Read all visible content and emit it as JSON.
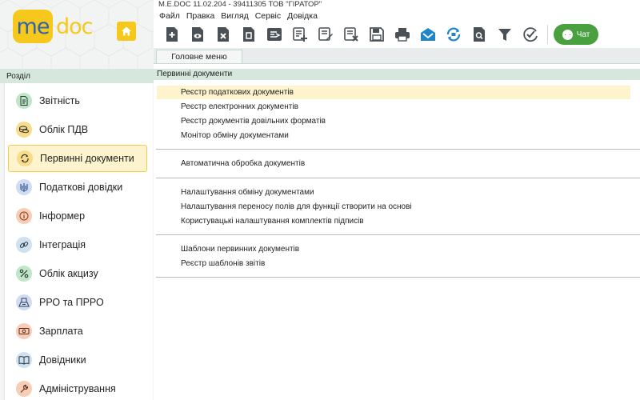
{
  "window": {
    "title": "M.E.DOC 11.02.204  - 39411305 ТОВ \"ГІРАТОР\""
  },
  "logo": {
    "part1": "me",
    "part2": "doc"
  },
  "menu": [
    "Файл",
    "Правка",
    "Вигляд",
    "Сервіс",
    "Довідка"
  ],
  "toolbar": {
    "icons": [
      "add-document-icon",
      "view-document-icon",
      "delete-document-icon",
      "copy-document-icon",
      "export-document-icon",
      "create-on-basis-icon",
      "edit-document-icon",
      "cancel-document-icon",
      "save-icon",
      "print-icon",
      "send-icon",
      "sync-icon",
      "preview-icon",
      "filter-icon",
      "check-icon"
    ],
    "chat_label": "Чат"
  },
  "tabs": [
    {
      "label": "Головне меню"
    }
  ],
  "sidebar": {
    "header": "Розділ",
    "items": [
      {
        "label": "Звітність",
        "icon": "document-icon",
        "color": "#bfe6c9"
      },
      {
        "label": "Облік ПДВ",
        "icon": "coins-icon",
        "color": "#f8dc8a"
      },
      {
        "label": "Первинні документи",
        "icon": "refresh-icon",
        "color": "#f8dc8a",
        "active": true
      },
      {
        "label": "Податкові довідки",
        "icon": "trident-icon",
        "color": "#d0dcf2"
      },
      {
        "label": "Інформер",
        "icon": "info-icon",
        "color": "#f8cdb6"
      },
      {
        "label": "Інтеграція",
        "icon": "link-icon",
        "color": "#cfe0ef"
      },
      {
        "label": "Облік акцизу",
        "icon": "percent-icon",
        "color": "#bfe6c9"
      },
      {
        "label": "РРО та ПРРО",
        "icon": "cash-register-icon",
        "color": "#d0dcf2"
      },
      {
        "label": "Зарплата",
        "icon": "money-icon",
        "color": "#f8cdb6"
      },
      {
        "label": "Довідники",
        "icon": "book-icon",
        "color": "#cfe0ef"
      },
      {
        "label": "Адміністрування",
        "icon": "wrench-icon",
        "color": "#f8cdb6"
      }
    ]
  },
  "main": {
    "header": "Первинні документи",
    "groups": [
      [
        "Реєстр податкових документів",
        "Реєстр електронних документів",
        "Реєстр документів довільних форматів",
        "Монітор обміну документами"
      ],
      [
        "Автоматична обробка документів"
      ],
      [
        "Налаштування обміну документами",
        "Налаштування переносу полів для функції створити на основі",
        "Користувацькі налаштування комплектів підписів"
      ],
      [
        "Шаблони первинних документів",
        "Реєстр шаблонів звітів"
      ]
    ]
  },
  "colors": {
    "accent_yellow": "#f6c81b",
    "logo_blue": "#2f63ad",
    "header_green": "#d6e7de",
    "toolbar_icon": "#4a5156",
    "toolbar_icon_blue": "#1e86c8",
    "chat_green": "#48a03f",
    "highlight": "#fdf3cd"
  }
}
